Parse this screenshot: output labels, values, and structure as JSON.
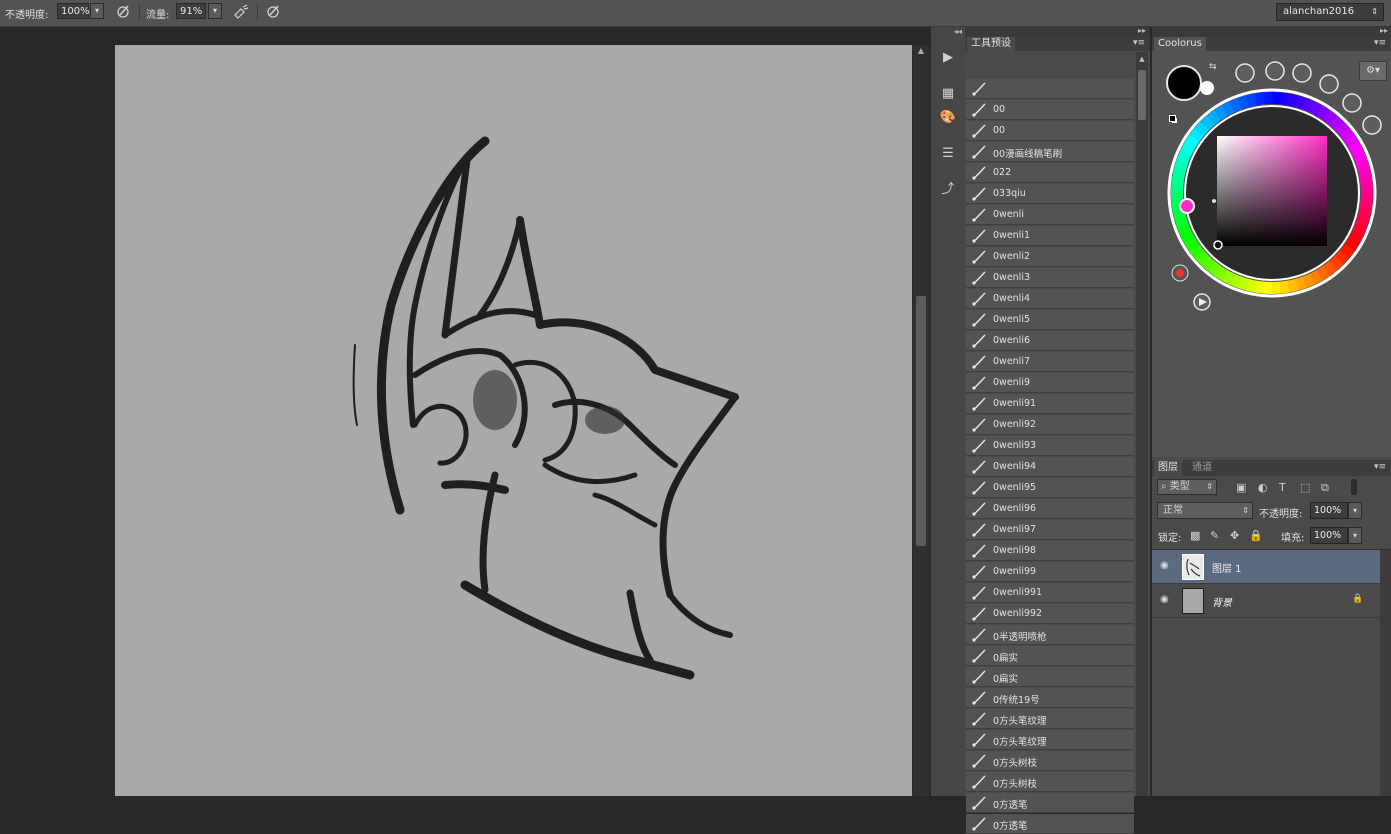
{
  "options_bar": {
    "opacity_label": "不透明度:",
    "opacity_value": "100%",
    "flow_label": "流量:",
    "flow_value": "91%",
    "user_name": "alanchan2016"
  },
  "tool_presets": {
    "tab_label": "工具预设",
    "items": [
      "",
      "00",
      "00",
      "00漫画线稿笔刷",
      "022",
      "033qiu",
      "0wenli",
      "0wenli1",
      "0wenli2",
      "0wenli3",
      "0wenli4",
      "0wenli5",
      "0wenli6",
      "0wenli7",
      "0wenli9",
      "0wenli91",
      "0wenli92",
      "0wenli93",
      "0wenli94",
      "0wenli95",
      "0wenli96",
      "0wenli97",
      "0wenli98",
      "0wenli99",
      "0wenli991",
      "0wenli992",
      "0半透明喷枪",
      "0扁实",
      "0扁实",
      "0传统19号",
      "0方头笔纹理",
      "0方头笔纹理",
      "0方头树枝",
      "0方头树枝",
      "0方透笔",
      "0方透笔"
    ]
  },
  "coolorus": {
    "tab_label": "Coolorus",
    "foreground_color": "#000000",
    "background_color": "#ffffff",
    "hue_color": "#ff2ec4"
  },
  "layers": {
    "tab_layers": "图层",
    "tab_channels": "通道",
    "filter_kind": "类型",
    "blend_mode": "正常",
    "opacity_label": "不透明度:",
    "opacity_value": "100%",
    "lock_label": "锁定:",
    "fill_label": "填充:",
    "fill_value": "100%",
    "items": [
      {
        "name": "图层 1",
        "selected": true
      },
      {
        "name": "背景",
        "selected": false
      }
    ]
  }
}
